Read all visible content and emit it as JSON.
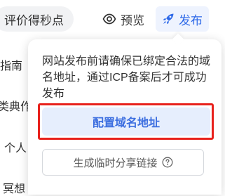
{
  "toolbar": {
    "chip_label": "评价得秒点",
    "preview_label": "预览",
    "publish_label": "发布",
    "publish_color": "#2f6ae8"
  },
  "background_doc": {
    "lines": [
      "指南",
      "类典作",
      "个人",
      "冥想"
    ]
  },
  "popover": {
    "message": "网站发布前请确保已绑定合法的域名地址，通过ICP备案后才可成功发布",
    "configure_label": "配置域名地址",
    "share_label": "生成临时分享链接",
    "highlight_color": "#e8211c"
  },
  "icons": {
    "preview": "eye-icon",
    "publish": "rocket-icon",
    "help": "question-circle-icon"
  }
}
